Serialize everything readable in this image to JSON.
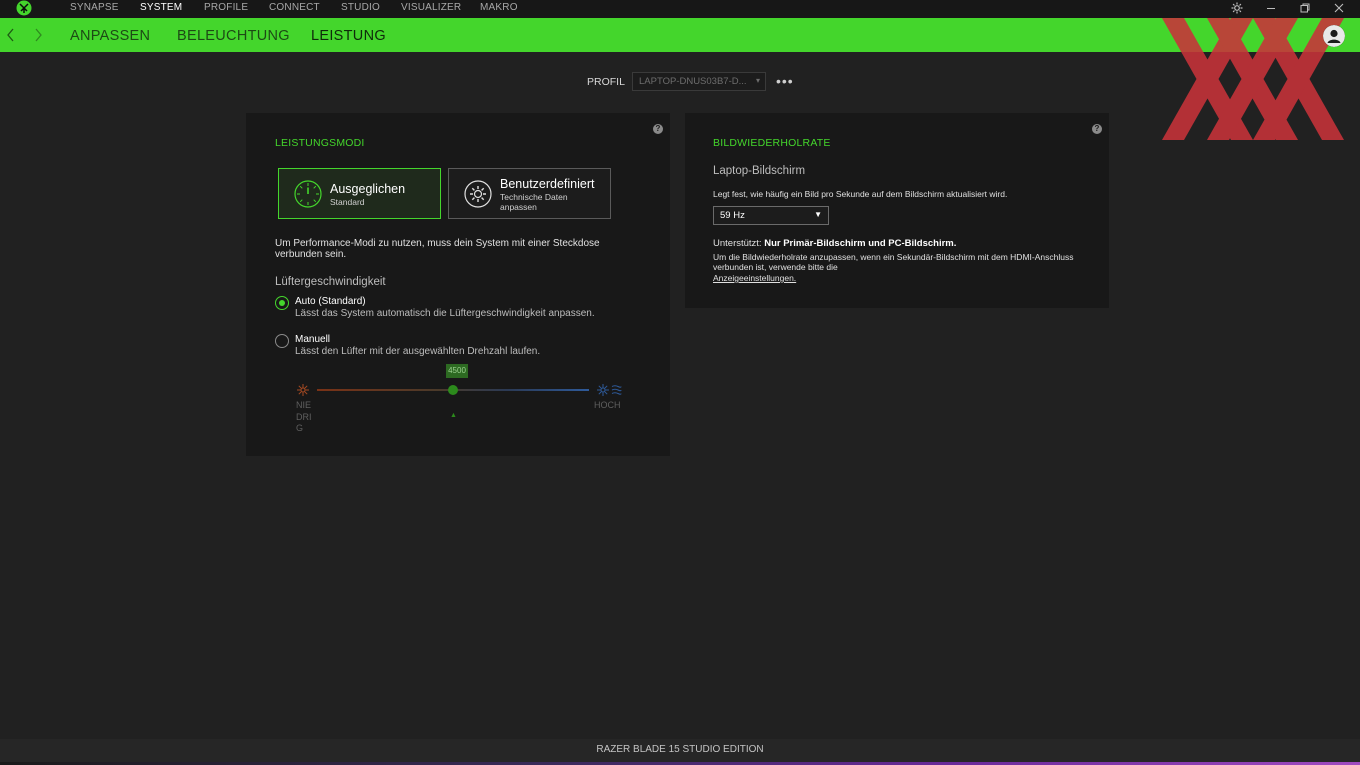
{
  "topnav": {
    "items": [
      "SYNAPSE",
      "SYSTEM",
      "PROFILE",
      "CONNECT",
      "STUDIO",
      "VISUALIZER",
      "MAKRO"
    ],
    "active": "SYSTEM"
  },
  "subnav": {
    "tabs": [
      "ANPASSEN",
      "BELEUCHTUNG",
      "LEISTUNG"
    ],
    "active": "LEISTUNG"
  },
  "profile": {
    "label": "PROFIL",
    "value": "LAPTOP-DNUS03B7-D..."
  },
  "performance": {
    "title": "LEISTUNGSMODI",
    "modes": [
      {
        "title": "Ausgeglichen",
        "sub": "Standard",
        "selected": true
      },
      {
        "title": "Benutzerdefiniert",
        "sub_line1": "Technische Daten",
        "sub_line2": "anpassen",
        "selected": false
      }
    ],
    "note_line1": "Um Performance-Modi zu nutzen, muss dein System mit einer Steckdose",
    "note_line2": "verbunden sein.",
    "fan_heading": "Lüftergeschwindigkeit",
    "fan_options": [
      {
        "label": "Auto (Standard)",
        "desc": "Lässt das System automatisch die Lüftergeschwindigkeit anpassen.",
        "selected": true
      },
      {
        "label": "Manuell",
        "desc": "Lässt den Lüfter mit der ausgewählten Drehzahl laufen.",
        "selected": false
      }
    ],
    "slider": {
      "value_label": "4500",
      "low_label_lines": [
        "NIE",
        "DRI",
        "G"
      ],
      "high_label": "HOCH",
      "fraction": 0.5
    }
  },
  "refresh": {
    "title": "BILDWIEDERHOLRATE",
    "screen_heading": "Laptop-Bildschirm",
    "description": "Legt fest, wie häufig ein Bild pro Sekunde auf dem Bildschirm aktualisiert wird.",
    "rate": "59 Hz",
    "supported_label": "Unterstützt:",
    "supported_value": "Nur Primär-Bildschirm und PC-Bildschirm.",
    "info_line1": "Um die Bildwiederholrate anzupassen, wenn ein Sekundär-Bildschirm mit dem HDMI-Anschluss",
    "info_line2": "verbunden ist, verwende bitte die",
    "link": "Anzeigeeinstellungen."
  },
  "help_glyph": "?",
  "more_glyph": "•••",
  "footer": {
    "device": "RAZER BLADE 15 STUDIO EDITION"
  },
  "colors": {
    "accent": "#44d62c",
    "background": "#212121",
    "panel": "#181818"
  },
  "icons": {
    "back": "chevron-left-icon",
    "forward": "chevron-right-icon",
    "settings": "gear-icon",
    "minimize": "minimize-icon",
    "restore": "restore-icon",
    "close": "close-icon"
  }
}
